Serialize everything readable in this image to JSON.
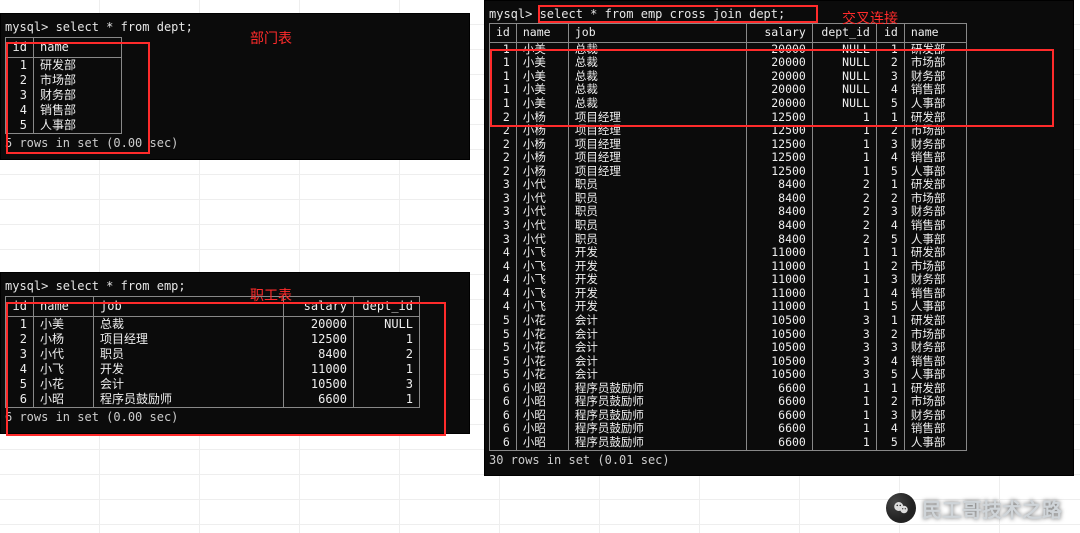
{
  "dept_query": "select * from dept;",
  "dept_label": "部门表",
  "dept_header": [
    "id",
    "name"
  ],
  "dept_rows": [
    [
      "1",
      "研发部"
    ],
    [
      "2",
      "市场部"
    ],
    [
      "3",
      "财务部"
    ],
    [
      "4",
      "销售部"
    ],
    [
      "5",
      "人事部"
    ]
  ],
  "dept_footer": "5 rows in set (0.00 sec)",
  "emp_query": "select * from emp;",
  "emp_label": "职工表",
  "emp_header": [
    "id",
    "name",
    "job",
    "salary",
    "dept_id"
  ],
  "emp_rows": [
    [
      "1",
      "小美",
      "总裁",
      "20000",
      "NULL"
    ],
    [
      "2",
      "小杨",
      "项目经理",
      "12500",
      "1"
    ],
    [
      "3",
      "小代",
      "职员",
      "8400",
      "2"
    ],
    [
      "4",
      "小飞",
      "开发",
      "11000",
      "1"
    ],
    [
      "5",
      "小花",
      "会计",
      "10500",
      "3"
    ],
    [
      "6",
      "小昭",
      "程序员鼓励师",
      "6600",
      "1"
    ]
  ],
  "emp_footer": "6 rows in set (0.00 sec)",
  "cross_query": "select * from emp cross join dept;",
  "cross_label": "交叉连接",
  "cross_header": [
    "id",
    "name",
    "job",
    "salary",
    "dept_id",
    "id",
    "name"
  ],
  "cross_rows": [
    [
      "1",
      "小美",
      "总裁",
      "20000",
      "NULL",
      "1",
      "研发部"
    ],
    [
      "1",
      "小美",
      "总裁",
      "20000",
      "NULL",
      "2",
      "市场部"
    ],
    [
      "1",
      "小美",
      "总裁",
      "20000",
      "NULL",
      "3",
      "财务部"
    ],
    [
      "1",
      "小美",
      "总裁",
      "20000",
      "NULL",
      "4",
      "销售部"
    ],
    [
      "1",
      "小美",
      "总裁",
      "20000",
      "NULL",
      "5",
      "人事部"
    ],
    [
      "2",
      "小杨",
      "项目经理",
      "12500",
      "1",
      "1",
      "研发部"
    ],
    [
      "2",
      "小杨",
      "项目经理",
      "12500",
      "1",
      "2",
      "市场部"
    ],
    [
      "2",
      "小杨",
      "项目经理",
      "12500",
      "1",
      "3",
      "财务部"
    ],
    [
      "2",
      "小杨",
      "项目经理",
      "12500",
      "1",
      "4",
      "销售部"
    ],
    [
      "2",
      "小杨",
      "项目经理",
      "12500",
      "1",
      "5",
      "人事部"
    ],
    [
      "3",
      "小代",
      "职员",
      "8400",
      "2",
      "1",
      "研发部"
    ],
    [
      "3",
      "小代",
      "职员",
      "8400",
      "2",
      "2",
      "市场部"
    ],
    [
      "3",
      "小代",
      "职员",
      "8400",
      "2",
      "3",
      "财务部"
    ],
    [
      "3",
      "小代",
      "职员",
      "8400",
      "2",
      "4",
      "销售部"
    ],
    [
      "3",
      "小代",
      "职员",
      "8400",
      "2",
      "5",
      "人事部"
    ],
    [
      "4",
      "小飞",
      "开发",
      "11000",
      "1",
      "1",
      "研发部"
    ],
    [
      "4",
      "小飞",
      "开发",
      "11000",
      "1",
      "2",
      "市场部"
    ],
    [
      "4",
      "小飞",
      "开发",
      "11000",
      "1",
      "3",
      "财务部"
    ],
    [
      "4",
      "小飞",
      "开发",
      "11000",
      "1",
      "4",
      "销售部"
    ],
    [
      "4",
      "小飞",
      "开发",
      "11000",
      "1",
      "5",
      "人事部"
    ],
    [
      "5",
      "小花",
      "会计",
      "10500",
      "3",
      "1",
      "研发部"
    ],
    [
      "5",
      "小花",
      "会计",
      "10500",
      "3",
      "2",
      "市场部"
    ],
    [
      "5",
      "小花",
      "会计",
      "10500",
      "3",
      "3",
      "财务部"
    ],
    [
      "5",
      "小花",
      "会计",
      "10500",
      "3",
      "4",
      "销售部"
    ],
    [
      "5",
      "小花",
      "会计",
      "10500",
      "3",
      "5",
      "人事部"
    ],
    [
      "6",
      "小昭",
      "程序员鼓励师",
      "6600",
      "1",
      "1",
      "研发部"
    ],
    [
      "6",
      "小昭",
      "程序员鼓励师",
      "6600",
      "1",
      "2",
      "市场部"
    ],
    [
      "6",
      "小昭",
      "程序员鼓励师",
      "6600",
      "1",
      "3",
      "财务部"
    ],
    [
      "6",
      "小昭",
      "程序员鼓励师",
      "6600",
      "1",
      "4",
      "销售部"
    ],
    [
      "6",
      "小昭",
      "程序员鼓励师",
      "6600",
      "1",
      "5",
      "人事部"
    ]
  ],
  "cross_footer": "30 rows in set (0.01 sec)",
  "watermark_text": "民工哥技术之路",
  "chart_data": {
    "type": "table",
    "tables": [
      {
        "name": "dept",
        "columns": [
          "id",
          "name"
        ],
        "rows": [
          [
            1,
            "研发部"
          ],
          [
            2,
            "市场部"
          ],
          [
            3,
            "财务部"
          ],
          [
            4,
            "销售部"
          ],
          [
            5,
            "人事部"
          ]
        ]
      },
      {
        "name": "emp",
        "columns": [
          "id",
          "name",
          "job",
          "salary",
          "dept_id"
        ],
        "rows": [
          [
            1,
            "小美",
            "总裁",
            20000,
            null
          ],
          [
            2,
            "小杨",
            "项目经理",
            12500,
            1
          ],
          [
            3,
            "小代",
            "职员",
            8400,
            2
          ],
          [
            4,
            "小飞",
            "开发",
            11000,
            1
          ],
          [
            5,
            "小花",
            "会计",
            10500,
            3
          ],
          [
            6,
            "小昭",
            "程序员鼓励师",
            6600,
            1
          ]
        ]
      },
      {
        "name": "emp_cross_join_dept",
        "columns": [
          "emp.id",
          "emp.name",
          "job",
          "salary",
          "dept_id",
          "dept.id",
          "dept.name"
        ],
        "rows": "cartesian product of emp × dept (30 rows)"
      }
    ]
  }
}
